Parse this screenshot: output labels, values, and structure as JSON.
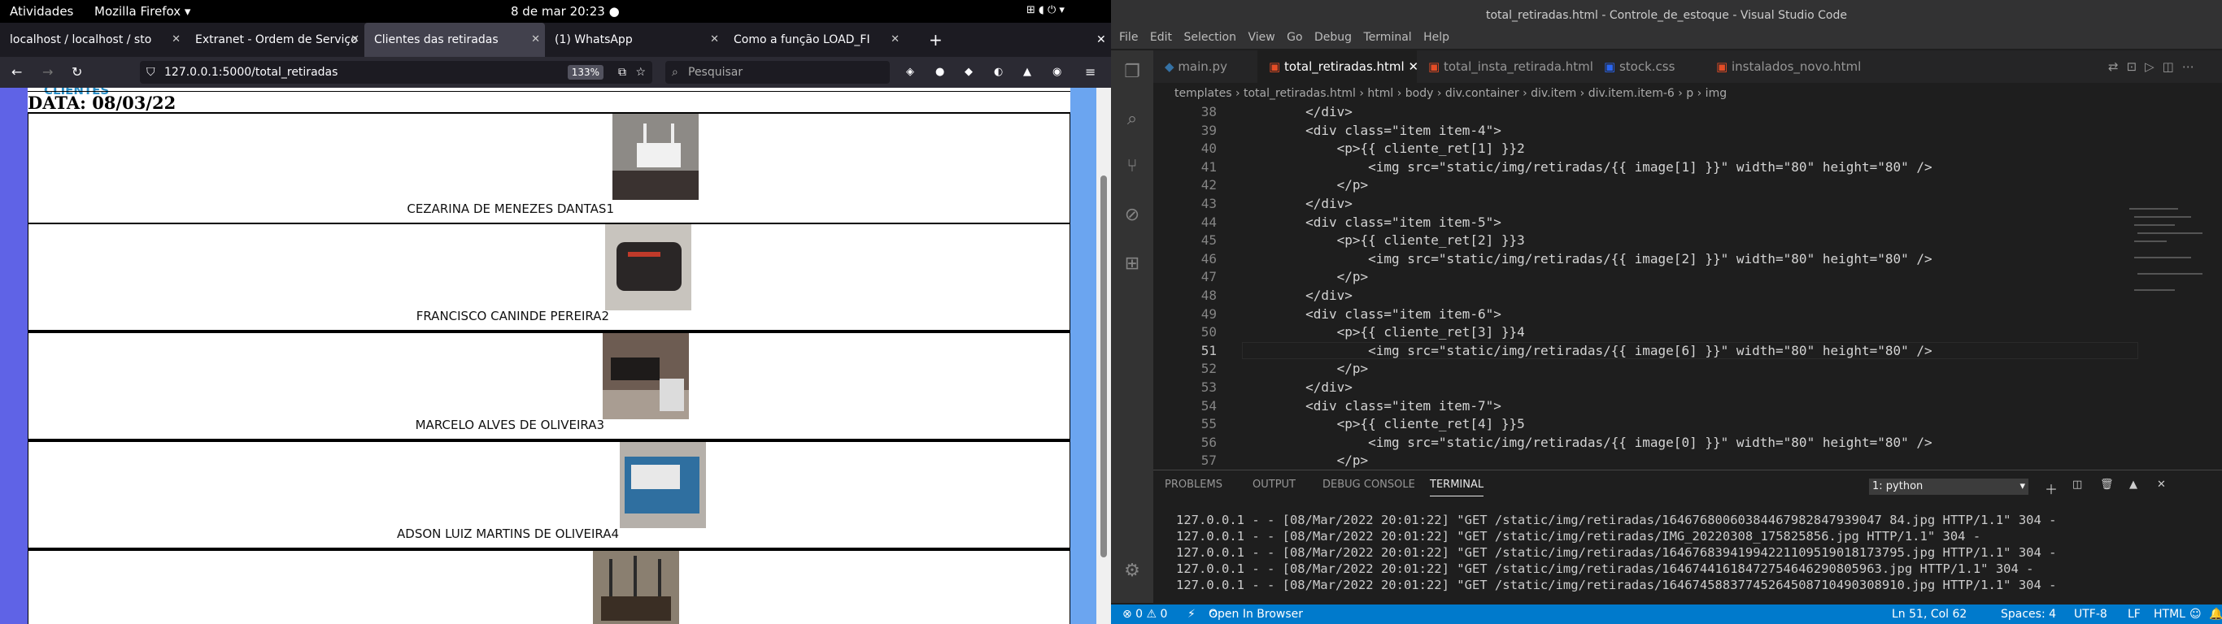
{
  "gnome": {
    "activities": "Atividades",
    "app": "Mozilla Firefox ▾",
    "datetime": "8 de mar  20:23 ●"
  },
  "firefox": {
    "tabs": [
      {
        "label": "localhost / localhost / sto"
      },
      {
        "label": "Extranet - Ordem de Serviço"
      },
      {
        "label": "Clientes das retiradas"
      },
      {
        "label": "(1) WhatsApp"
      },
      {
        "label": "Como a função LOAD_FI"
      }
    ],
    "url": "127.0.0.1:5000/total_retiradas",
    "zoom": "133%",
    "search_placeholder": "Pesquisar"
  },
  "page": {
    "header_partial": "CLIENTES",
    "date": "DATA: 08/03/22",
    "rows": [
      {
        "label": "CEZARINA DE MENEZES DANTAS1"
      },
      {
        "label": "FRANCISCO CANINDE PEREIRA2"
      },
      {
        "label": "MARCELO ALVES DE OLIVEIRA3"
      },
      {
        "label": "ADSON LUIZ MARTINS DE OLIVEIRA4"
      }
    ]
  },
  "vscode": {
    "title": "total_retiradas.html - Controle_de_estoque - Visual Studio Code",
    "menu": [
      "File",
      "Edit",
      "Selection",
      "View",
      "Go",
      "Debug",
      "Terminal",
      "Help"
    ],
    "tabs": [
      {
        "label": "main.py"
      },
      {
        "label": "total_retiradas.html"
      },
      {
        "label": "total_insta_retirada.html"
      },
      {
        "label": "stock.css"
      },
      {
        "label": "instalados_novo.html"
      }
    ],
    "breadcrumb": "templates › total_retiradas.html › html › body › div.container › div.item › div.item.item-6 › p › img",
    "lines": [
      {
        "n": "38",
        "t": "        </div>"
      },
      {
        "n": "39",
        "t": "        <div class=\"item item-4\">"
      },
      {
        "n": "40",
        "t": "            <p>{{ cliente_ret[1] }}2"
      },
      {
        "n": "41",
        "t": "                <img src=\"static/img/retiradas/{{ image[1] }}\" width=\"80\" height=\"80\" />"
      },
      {
        "n": "42",
        "t": "            </p>"
      },
      {
        "n": "43",
        "t": "        </div>"
      },
      {
        "n": "44",
        "t": "        <div class=\"item item-5\">"
      },
      {
        "n": "45",
        "t": "            <p>{{ cliente_ret[2] }}3"
      },
      {
        "n": "46",
        "t": "                <img src=\"static/img/retiradas/{{ image[2] }}\" width=\"80\" height=\"80\" />"
      },
      {
        "n": "47",
        "t": "            </p>"
      },
      {
        "n": "48",
        "t": "        </div>"
      },
      {
        "n": "49",
        "t": "        <div class=\"item item-6\">"
      },
      {
        "n": "50",
        "t": "            <p>{{ cliente_ret[3] }}4"
      },
      {
        "n": "51",
        "t": "                <img src=\"static/img/retiradas/{{ image[6] }}\" width=\"80\" height=\"80\" />"
      },
      {
        "n": "52",
        "t": "            </p>"
      },
      {
        "n": "53",
        "t": "        </div>"
      },
      {
        "n": "54",
        "t": "        <div class=\"item item-7\">"
      },
      {
        "n": "55",
        "t": "            <p>{{ cliente_ret[4] }}5"
      },
      {
        "n": "56",
        "t": "                <img src=\"static/img/retiradas/{{ image[0] }}\" width=\"80\" height=\"80\" />"
      },
      {
        "n": "57",
        "t": "            </p>"
      }
    ],
    "panel_tabs": [
      "PROBLEMS",
      "OUTPUT",
      "DEBUG CONSOLE",
      "TERMINAL"
    ],
    "terminal_select": "1: python",
    "terminal": [
      "127.0.0.1 - - [08/Mar/2022 20:01:22] \"GET /static/img/retiradas/16467680060384467982847939047 84.jpg HTTP/1.1\" 304 -",
      "127.0.0.1 - - [08/Mar/2022 20:01:22] \"GET /static/img/retiradas/IMG_20220308_175825856.jpg HTTP/1.1\" 304 -",
      "127.0.0.1 - - [08/Mar/2022 20:01:22] \"GET /static/img/retiradas/16467683941994221109519018173795.jpg HTTP/1.1\" 304 -",
      "127.0.0.1 - - [08/Mar/2022 20:01:22] \"GET /static/img/retiradas/16467441618472754646290805963.jpg HTTP/1.1\" 304 -",
      "127.0.0.1 - - [08/Mar/2022 20:01:22] \"GET /static/img/retiradas/16467458837745264508710490308910.jpg HTTP/1.1\" 304 -"
    ],
    "status": {
      "problems": "⊗ 0 ⚠ 0",
      "browser": "Open In Browser",
      "position": "Ln 51, Col 62",
      "spaces": "Spaces: 4",
      "encoding": "UTF-8",
      "eol": "LF",
      "lang": "HTML"
    }
  }
}
